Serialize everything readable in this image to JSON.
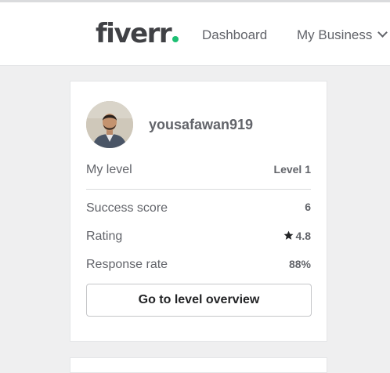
{
  "header": {
    "logo_text": "fiverr",
    "logo_dot_color": "#1dbf73",
    "nav": {
      "dashboard_label": "Dashboard",
      "business_label": "My Business"
    }
  },
  "profile": {
    "username": "yousafawan919",
    "avatar_icon": "user-avatar-photo",
    "level_label": "My level",
    "level_value": "Level 1",
    "stats": [
      {
        "label": "Success score",
        "value": "6"
      },
      {
        "label": "Rating",
        "value": "4.8",
        "icon": "star-icon"
      },
      {
        "label": "Response rate",
        "value": "88%"
      }
    ],
    "button_label": "Go to level overview"
  }
}
